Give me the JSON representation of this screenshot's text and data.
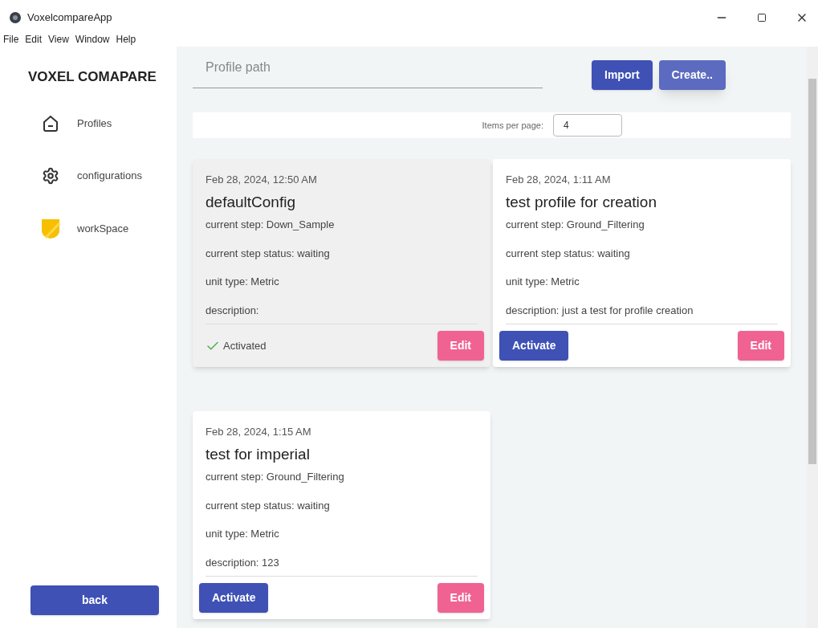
{
  "window": {
    "title": "VoxelcompareApp"
  },
  "menu": [
    "File",
    "Edit",
    "View",
    "Window",
    "Help"
  ],
  "sidebar": {
    "title": "VOXEL COMAPARE",
    "items": [
      {
        "label": "Profiles",
        "kind": "home"
      },
      {
        "label": "configurations",
        "kind": "gear"
      },
      {
        "label": "workSpace",
        "kind": "shield"
      }
    ],
    "back": "back"
  },
  "toolbar": {
    "placeholder": "Profile path",
    "import": "Import",
    "create": "Create.."
  },
  "paginator": {
    "label": "Items per page:",
    "value": "4"
  },
  "profiles": [
    {
      "date": "Feb 28, 2024, 12:50 AM",
      "name": "defaultConfig",
      "step": "current step: Down_Sample",
      "status": "current step status: waiting",
      "unit": "unit type: Metric",
      "description": "description:",
      "activated": true,
      "activated_label": "Activated",
      "edit": "Edit"
    },
    {
      "date": "Feb 28, 2024, 1:11 AM",
      "name": "test profile for creation",
      "step": "current step: Ground_Filtering",
      "status": "current step status: waiting",
      "unit": "unit type: Metric",
      "description": "description: just a test for profile creation",
      "activated": false,
      "activate_label": "Activate",
      "edit": "Edit"
    },
    {
      "date": "Feb 28, 2024, 1:15 AM",
      "name": "test for imperial",
      "step": "current step: Ground_Filtering",
      "status": "current step status: waiting",
      "unit": "unit type: Metric",
      "description": "description: 123",
      "activated": false,
      "activate_label": "Activate",
      "edit": "Edit"
    }
  ]
}
